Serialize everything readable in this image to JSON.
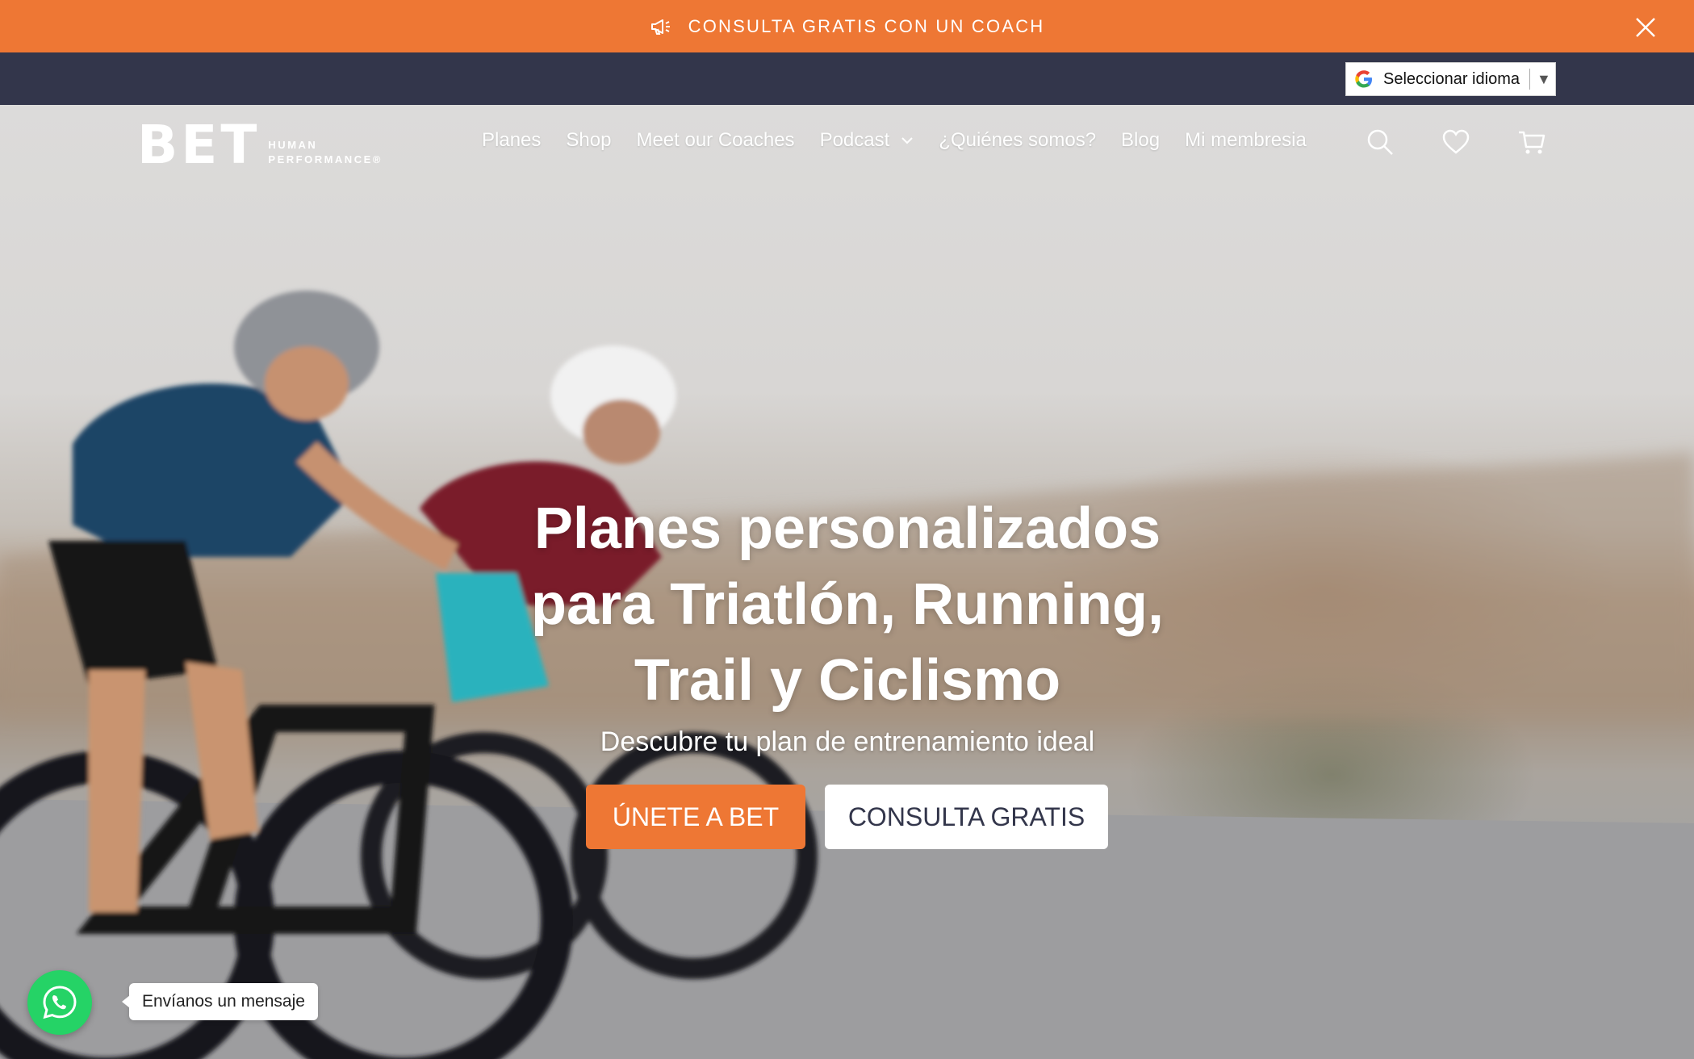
{
  "announcement": {
    "text": "CONSULTA GRATIS CON UN COACH",
    "icon": "megaphone-icon",
    "close_icon": "close-icon"
  },
  "translate_widget": {
    "label": "Seleccionar idioma",
    "arrow": "▼",
    "icon": "google-icon"
  },
  "header": {
    "logo": {
      "mark": "BET",
      "line1": "HUMAN",
      "line2": "PERFORMANCE®"
    },
    "nav": [
      {
        "label": "Planes"
      },
      {
        "label": "Shop"
      },
      {
        "label": "Meet our Coaches"
      },
      {
        "label": "Podcast",
        "has_dropdown": true
      },
      {
        "label": "¿Quiénes somos?"
      },
      {
        "label": "Blog"
      },
      {
        "label": "Mi membresia"
      }
    ],
    "icons": [
      "search-icon",
      "heart-icon",
      "cart-icon"
    ]
  },
  "hero": {
    "title_lines": [
      "Planes personalizados",
      "para Triatlón, Running,",
      "Trail y Ciclismo"
    ],
    "subtitle": "Descubre tu plan de entrenamiento ideal",
    "primary_button": "ÚNETE A BET",
    "secondary_button": "CONSULTA GRATIS"
  },
  "whatsapp": {
    "icon": "whatsapp-icon",
    "bubble_text": "Envíanos un mensaje"
  },
  "colors": {
    "brand_orange": "#ee7734",
    "navy": "#33364b",
    "whatsapp_green": "#25d366",
    "white": "#ffffff"
  }
}
